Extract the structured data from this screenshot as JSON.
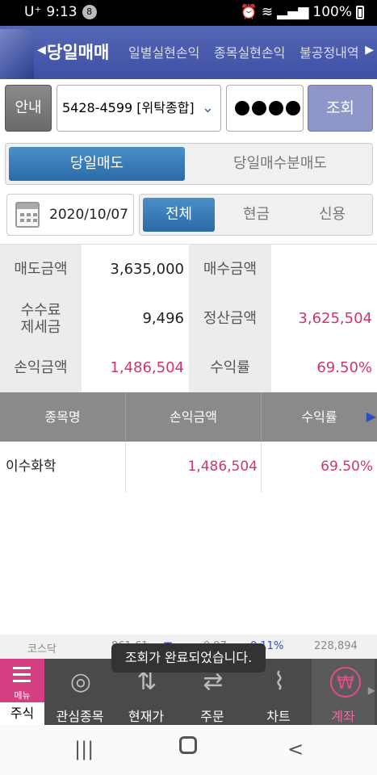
{
  "status_bar": {
    "carrier": "U⁺",
    "time": "9:13",
    "notif_count": "8",
    "battery": "100%"
  },
  "header": {
    "tabs": [
      "당일매매",
      "일별실현손익",
      "종목실현손익",
      "불공정내역"
    ],
    "active_tab": "당일매매"
  },
  "account_row": {
    "guide_label": "안내",
    "account": "5428-4599 [위탁종합]",
    "query_label": "조회"
  },
  "sell_tabs": {
    "tab1": "당일매도",
    "tab2": "당일매수분매도",
    "active": "당일매도"
  },
  "filter": {
    "date": "2020/10/07",
    "options": [
      "전체",
      "현금",
      "신용"
    ],
    "active": "전체"
  },
  "summary": {
    "sell_amount_label": "매도금액",
    "sell_amount": "3,635,000",
    "buy_amount_label": "매수금액",
    "buy_amount": "",
    "fee_label_1": "수수료",
    "fee_label_2": "제세금",
    "fee": "9,496",
    "settle_label": "정산금액",
    "settle": "3,625,504",
    "pnl_label": "손익금액",
    "pnl": "1,486,504",
    "return_label": "수익률",
    "return": "69.50%"
  },
  "table": {
    "headers": [
      "종목명",
      "손익금액",
      "수익률"
    ],
    "rows": [
      {
        "name": "이수화학",
        "pnl": "1,486,504",
        "return": "69.50%"
      }
    ]
  },
  "ticker": {
    "index": "코스닥",
    "value": "861.61",
    "change": "0.97",
    "pct": "0.11%",
    "volume": "228,894"
  },
  "toast": "조회가 완료되었습니다.",
  "bottom_nav": {
    "menu_label": "메뉴",
    "stock_label": "주식",
    "items": [
      "관심종목",
      "현재가",
      "주문",
      "차트",
      "계좌"
    ],
    "active": "계좌"
  },
  "colors": {
    "header_blue": "#4456a8",
    "accent_pink": "#d4336b",
    "active_blue": "#2f73b5"
  }
}
